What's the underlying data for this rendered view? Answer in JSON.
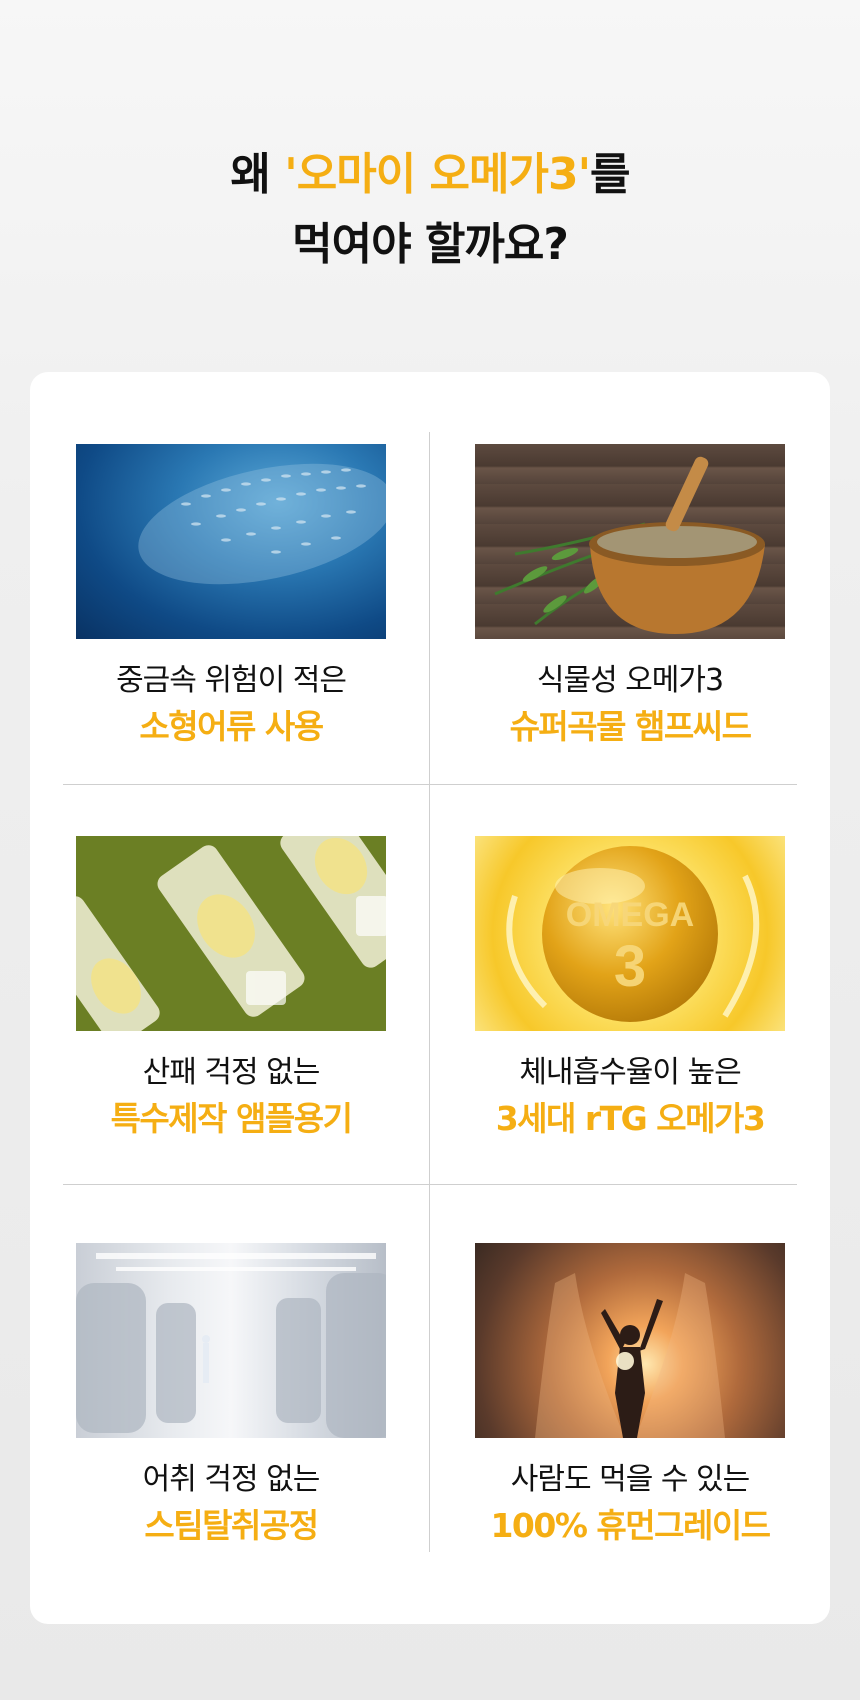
{
  "headline": {
    "prefix": "왜 ",
    "accent": "'오마이 오메가3'",
    "suffix": "를",
    "line2": "먹여야 할까요?"
  },
  "colors": {
    "accent": "#f5ae13",
    "text": "#111111"
  },
  "features": [
    {
      "image": "school-of-fish-photo",
      "line1": "중금속 위험이 적은",
      "line2": "소형어류 사용"
    },
    {
      "image": "hemp-seed-bowl-photo",
      "line1": "식물성 오메가3",
      "line2": "슈퍼곡물 햄프씨드"
    },
    {
      "image": "ampoule-container-photo",
      "line1": "산패 걱정 없는",
      "line2": "특수제작 앰플용기"
    },
    {
      "image": "omega3-capsule-photo",
      "line1": "체내흡수율이 높은",
      "line2": "3세대 rTG 오메가3",
      "photo_text1": "OMEGA",
      "photo_text2": "3"
    },
    {
      "image": "factory-process-photo",
      "line1": "어취 걱정 없는",
      "line2": "스팀탈취공정"
    },
    {
      "image": "human-grade-photo",
      "line1": "사람도 먹을 수 있는",
      "line2": "100% 휴먼그레이드"
    }
  ]
}
